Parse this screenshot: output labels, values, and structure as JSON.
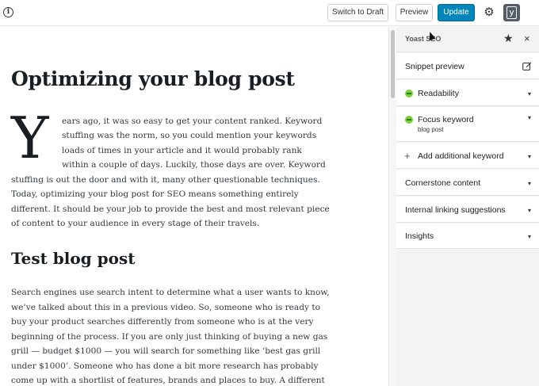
{
  "toolbar": {
    "info_icon": "i",
    "switch_draft": "Switch to Draft",
    "preview": "Preview",
    "update": "Update",
    "gear_icon": "⚙",
    "yoast_icon": "y"
  },
  "editor": {
    "title": "Optimizing your blog post",
    "dropcap": "Y",
    "para1": [
      "ears ago, it was so easy to get your content ranked. Keyword",
      "stuffing was the norm, so you could mention your keywords",
      "loads of times in your article and it would probably rank",
      "within a couple of days. Luckily, those days are over. Keyword",
      "stuffing is out the door and with it, many other questionable techniques.",
      "Today, optimizing your blog post for SEO means something entirely",
      "different. It should be your job to provide the best and most relevant piece",
      "of content to your audience in every stage of their travels."
    ],
    "heading2": "Test blog post",
    "para2": [
      "Search engines use search intent to determine what a user wants to know,",
      "we’ve talked about this in a previous video. So, someone who is ready to",
      "buy your product searches differently from someone who is at the very",
      "beginning of the process. If you are only just thinking of buying a new gas",
      "grill — budget $1000 — you will search for something like ‘best gas grill",
      "under $1000’. Someone who has done a bit more research has probably",
      "come up with a shortlist of features, brands and places to buy. A different"
    ]
  },
  "sidebar": {
    "title": "Yoast SEO",
    "star_icon": "★",
    "close_icon": "×",
    "caret_icon": "▾",
    "panels": {
      "snippet": "Snippet preview",
      "readability": "Readability",
      "focus": "Focus keyword",
      "focus_value": "blog post",
      "add_keyword": "Add additional keyword",
      "cornerstone": "Cornerstone content",
      "internal_linking": "Internal linking suggestions",
      "insights": "Insights"
    },
    "plus_icon": "+"
  },
  "colors": {
    "update_button": "#0085ba",
    "good_dot": "#7ad03a",
    "sidebar_bg": "#f3f3f3"
  }
}
